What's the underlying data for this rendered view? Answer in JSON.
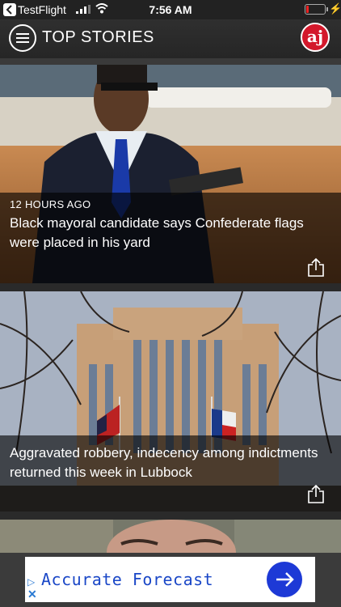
{
  "status_bar": {
    "carrier": "TestFlight",
    "time": "7:56 AM"
  },
  "header": {
    "title": "TOP STORIES",
    "logo_text": "aj",
    "logo_color": "#d3182b"
  },
  "stories": [
    {
      "time": "12 HOURS AGO",
      "headline": "Black mayoral candidate says Confederate flags were placed in his yard"
    },
    {
      "time": "",
      "headline": "Aggravated robbery, indecency among indictments returned this week in Lubbock"
    }
  ],
  "ad": {
    "text": "Accurate Forecast",
    "accent": "#1d39d6"
  },
  "icons": [
    "back-icon",
    "signal-icon",
    "wifi-icon",
    "battery-icon",
    "charging-icon",
    "menu-icon",
    "share-icon",
    "ad-choices-icon",
    "close-icon",
    "arrow-right-icon"
  ]
}
